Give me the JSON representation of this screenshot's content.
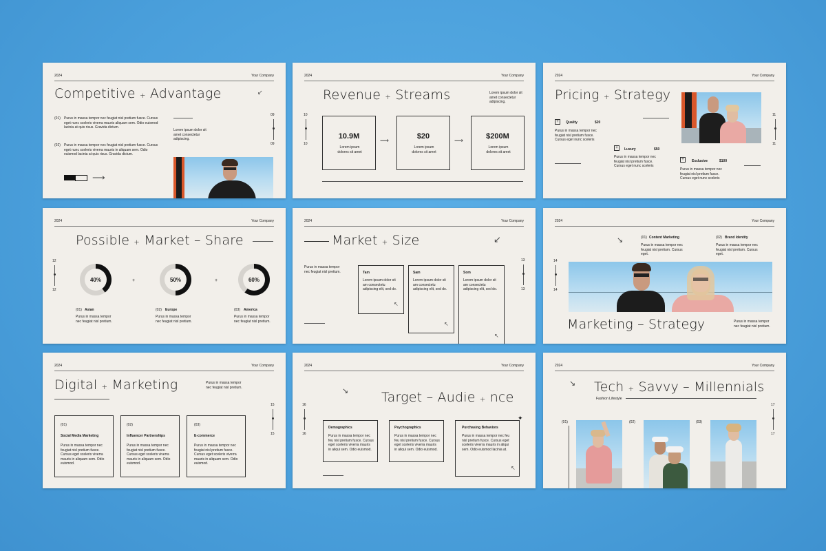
{
  "common": {
    "year": "2024",
    "company": "Your Company",
    "lorem_long": "Purus in massa tempor nec feugiat nisl pretium fusce. Cursus eget nunc scelerisque viverra mauris in aliquam sem. Odio euismod lacinia at quis risus. Gravida dictum.",
    "lorem_short": "Lorem ipsum dolor sit amet consectetur adipiscing.",
    "lorem_tiny": "Lorem ipsum dolor sit amet"
  },
  "s1": {
    "title_a": "Competitive",
    "title_b": "Advantage",
    "item1_no": "(01)",
    "item2_no": "(02)",
    "item1": "Purus in massa tempor nec feugiat nisl pretium fusce. Cursus eget nunc sceleris viverra mauris aliquam sem. Odio euismod lacinia at quis risus. Gravida dictum.",
    "item2": "Purus in massa tempor nec feugiat nisl pretium fusce. Cursus eget nunc sceleris viverra mauris in aliquam sem. Odio euismod lacinia at quis risus. Gravida dictum.",
    "side": "Lorem ipsum dolor sit amet consectetur adipiscing.",
    "n_top": "09",
    "n_bot": "09"
  },
  "s2": {
    "title_a": "Revenue",
    "title_b": "Streams",
    "intro": "Lorem ipsum dolor sit amet consectetur adipiscing.",
    "stats": [
      {
        "value": "10.9M",
        "desc": "Lorem ipsum dolores sit amet"
      },
      {
        "value": "$20",
        "desc": "Lorem ipsum dolores sit amet"
      },
      {
        "value": "$200M",
        "desc": "Lorem ipsum dolores sit amet"
      }
    ],
    "n_top": "10",
    "n_bot": "10"
  },
  "s3": {
    "title_a": "Pricing",
    "title_b": "Strategy",
    "tiers": [
      {
        "name": "Quality",
        "price": "$20"
      },
      {
        "name": "Luxury",
        "price": "$50"
      },
      {
        "name": "Exclusive",
        "price": "$100"
      }
    ],
    "desc": "Purus in massa tempor nec feugiat nisl pretium fusce. Cursus eget nunc sceleris",
    "n_top": "11",
    "n_bot": "11"
  },
  "s4": {
    "title_a": "Possible",
    "title_b": "Market",
    "title_c": "Share",
    "donuts": [
      {
        "pct": "40%",
        "no": "(01)",
        "name": "Asian",
        "value": 40
      },
      {
        "pct": "50%",
        "no": "(02)",
        "name": "Europe",
        "value": 50
      },
      {
        "pct": "60%",
        "no": "(03)",
        "name": "America",
        "value": 60
      }
    ],
    "desc": "Purus in massa tempor nec feugiat nisl pretium.",
    "n_top": "12",
    "n_bot": "12"
  },
  "s5": {
    "title_a": "Market",
    "title_b": "Size",
    "intro": "Purus in massa tempor nec feugiat nisl pretium.",
    "cards": [
      {
        "name": "Tam",
        "desc": "Lorem ipsum dolor sit am consectetu adipiscing elit, sed do."
      },
      {
        "name": "Sam",
        "desc": "Lorem ipsum dolor sit am consectetu adipiscing elit, sed do."
      },
      {
        "name": "Som",
        "desc": "Lorem ipsum dolor sit am consectetu adipiscing elit, sed do."
      }
    ],
    "n_top": "13",
    "n_bot": "13"
  },
  "s6": {
    "title_a": "Marketing",
    "title_b": "Strategy",
    "items": [
      {
        "no": "(01)",
        "name": "Content Marketing",
        "desc": "Purus in massa tempor nec feugiat nisl pretium. Cursus eget."
      },
      {
        "no": "(02)",
        "name": "Brand Identity",
        "desc": "Purus in massa tempor nec feugiat nisl pretium. Cursus eget."
      }
    ],
    "side": "Purus in massa tempor nec feugiat nisl pretium.",
    "n_top": "14",
    "n_bot": "14"
  },
  "s7": {
    "title_a": "Digital",
    "title_b": "Marketing",
    "intro": "Purus in massa tempor nec feugiat nisl pretium.",
    "cards": [
      {
        "no": "(01)",
        "name": "Social Media Marketing",
        "desc": "Purus in massa tempor nec feugiat nisl pretium fusce. Cursus eget sceleris viverra mauris in aliquam sem. Odio euismod."
      },
      {
        "no": "(02)",
        "name": "Influencer Partnerships",
        "desc": "Purus in massa tempor nec feugiat nisl pretium fusce. Cursus eget sceleris viverra mauris in aliquam sem. Odio euismod."
      },
      {
        "no": "(03)",
        "name": "E-commerce",
        "desc": "Purus in massa tempor nec feugiat nisl pretium fusce. Cursus eget sceleris viverra mauris in aliquam sem. Odio euismod."
      }
    ],
    "n_top": "15",
    "n_bot": "15"
  },
  "s8": {
    "title_a": "Target",
    "title_b": "Audie",
    "title_c": "nce",
    "cards": [
      {
        "name": "Demographics",
        "desc": "Purus in massa tempor nec feu nisl pretium fusce. Cursus eget sceleris viverra mauris in aliqui sem. Odio euismod."
      },
      {
        "name": "Psychographics",
        "desc": "Purus in massa tempor nec feu nisl pretium fusce. Cursus eget sceleris viverra mauris in aliqui sem. Odio euismod."
      },
      {
        "name": "Purchasing Behaviors",
        "desc": "Purus in massa tempor nec feu nisl pretium fusce. Cursus eget sceleris viverra mauris in aliqui sem. Odio euismod lacinia at."
      }
    ],
    "n_top": "16",
    "n_bot": "16"
  },
  "s9": {
    "title_a": "Tech",
    "title_b": "Savvy",
    "title_c": "Millennials",
    "subtitle": "Fashion Lifestyle",
    "nos": [
      "(01)",
      "(02)",
      "(03)"
    ],
    "n_top": "17",
    "n_bot": "17"
  }
}
